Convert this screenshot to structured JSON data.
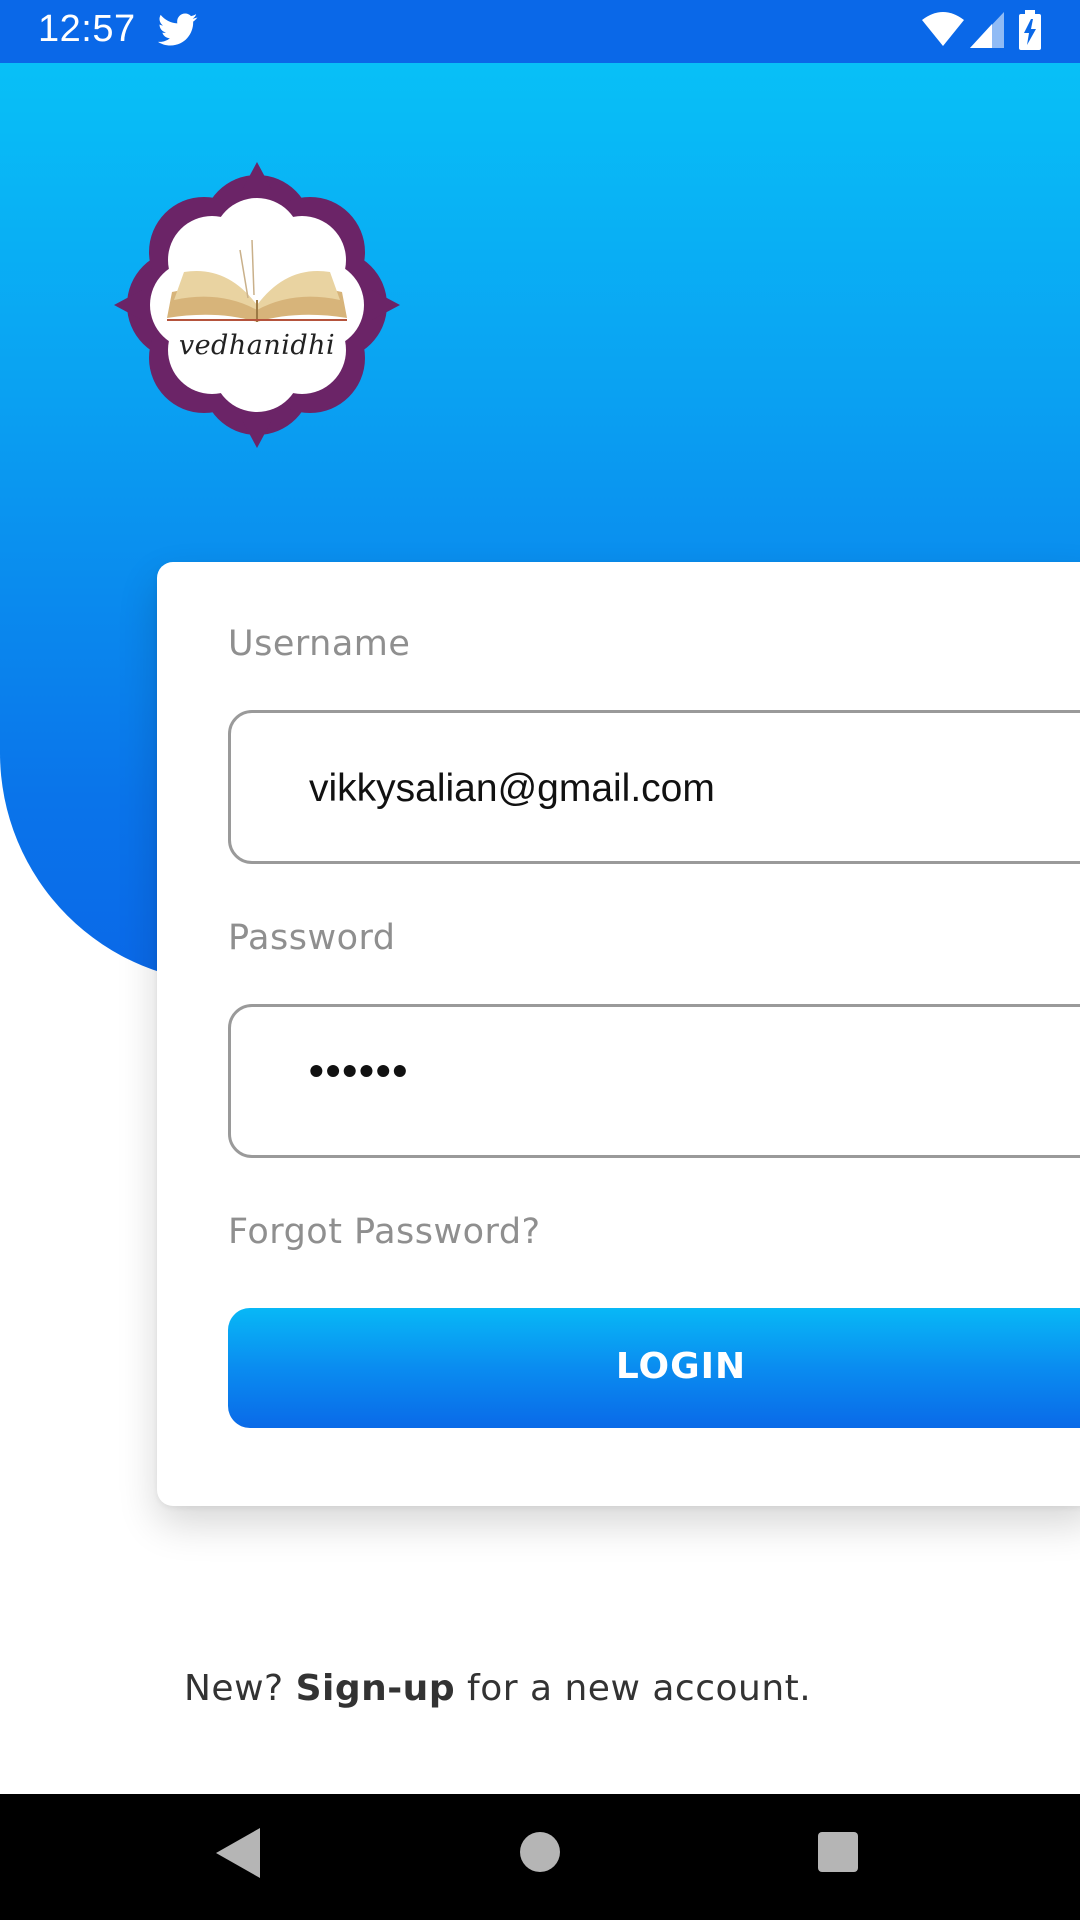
{
  "status_bar": {
    "time": "12:57",
    "notification_icon": "twitter-icon",
    "right_icons": [
      "wifi-icon",
      "signal-icon",
      "battery-charging-icon"
    ]
  },
  "logo": {
    "text": "vedhanidhi",
    "colors": {
      "petal": "#6b2467",
      "inner": "#ffffff"
    }
  },
  "form": {
    "username_label": "Username",
    "username_value": "vikkysalian@gmail.com",
    "password_label": "Password",
    "password_value_masked": "••••••",
    "forgot_password": "Forgot Password?",
    "login_button": "LOGIN"
  },
  "footer": {
    "prefix": "New? ",
    "signup_link": "Sign-up",
    "suffix": " for a new account."
  },
  "nav_bar": {
    "icons": [
      "back-icon",
      "home-icon",
      "recent-apps-icon"
    ]
  },
  "colors": {
    "accent_top": "#08c0f7",
    "accent_bottom": "#0a68e8",
    "label_gray": "#8f8f8f"
  }
}
